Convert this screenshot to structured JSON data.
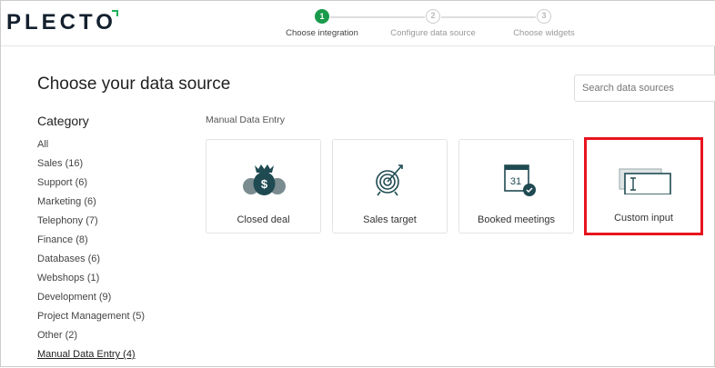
{
  "header": {
    "logo": "PLECTO",
    "steps": [
      {
        "num": "1",
        "label": "Choose integration",
        "active": true
      },
      {
        "num": "2",
        "label": "Configure data source",
        "active": false
      },
      {
        "num": "3",
        "label": "Choose widgets",
        "active": false
      }
    ]
  },
  "main": {
    "title": "Choose your data source",
    "search_placeholder": "Search data sources",
    "category_heading": "Category",
    "categories": [
      "All",
      "Sales (16)",
      "Support (6)",
      "Marketing (6)",
      "Telephony (7)",
      "Finance (8)",
      "Databases (6)",
      "Webshops (1)",
      "Development (9)",
      "Project Management (5)",
      "Other (2)",
      "Manual Data Entry (4)"
    ],
    "section_title": "Manual Data Entry",
    "cards": [
      {
        "label": "Closed deal",
        "icon": "money-bags-icon"
      },
      {
        "label": "Sales target",
        "icon": "target-icon"
      },
      {
        "label": "Booked meetings",
        "icon": "calendar-check-icon"
      },
      {
        "label": "Custom input",
        "icon": "text-input-icon"
      }
    ]
  },
  "colors": {
    "accent": "#1a9b4b",
    "highlight": "#e8141e",
    "icon": "#1f4a52"
  }
}
